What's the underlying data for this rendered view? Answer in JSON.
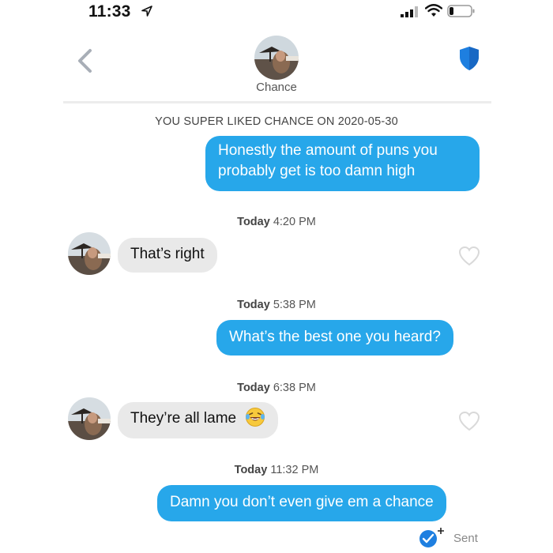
{
  "status_bar": {
    "time": "11:33",
    "icons": [
      "location-arrow-icon",
      "signal-icon",
      "wifi-icon",
      "battery-icon"
    ]
  },
  "header": {
    "name": "Chance",
    "back_icon": "chevron-left-icon",
    "safety_icon": "shield-icon"
  },
  "superlike_note": "YOU SUPER LIKED CHANCE ON 2020-05-30",
  "messages": [
    {
      "from": "me",
      "text": "Honestly the amount of puns you probably get is too damn high",
      "lines": [
        "Honestly the amount of puns you",
        "probably get is too damn high"
      ]
    },
    {
      "stamp_day": "Today",
      "stamp_time": "4:20 PM"
    },
    {
      "from": "them",
      "text": "That’s right"
    },
    {
      "stamp_day": "Today",
      "stamp_time": "5:38 PM"
    },
    {
      "from": "me",
      "text": "What’s the best one you heard?"
    },
    {
      "stamp_day": "Today",
      "stamp_time": "6:38 PM"
    },
    {
      "from": "them",
      "text": "They’re all lame",
      "emoji": "laughing-tears-emoji-icon"
    },
    {
      "stamp_day": "Today",
      "stamp_time": "11:32 PM"
    },
    {
      "from": "me",
      "text": "Damn you don’t even give em a chance"
    }
  ],
  "receipt": {
    "label": "Sent"
  },
  "colors": {
    "outgoing_bubble": "#27a7ea",
    "incoming_bubble": "#e9e9e9",
    "shield": "#1e7fe0"
  }
}
